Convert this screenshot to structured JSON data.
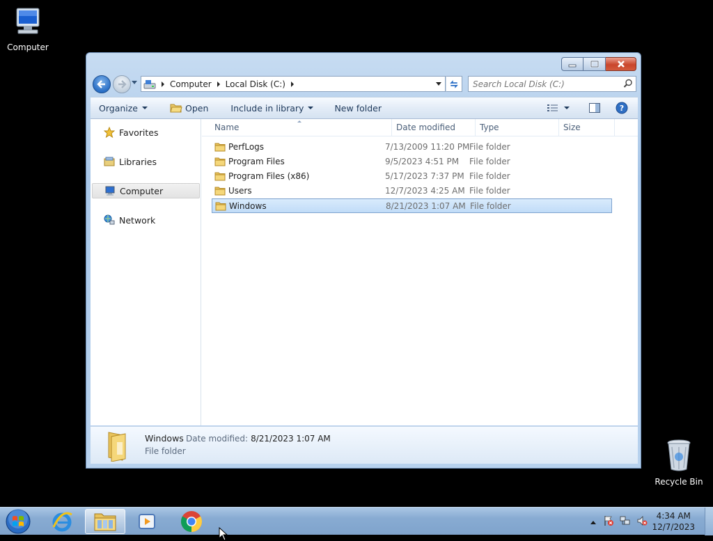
{
  "desktop": {
    "computer_label": "Computer",
    "recycle_bin_label": "Recycle Bin"
  },
  "window": {
    "address": {
      "crumbs": [
        "Computer",
        "Local Disk (C:)"
      ]
    },
    "search": {
      "placeholder": "Search Local Disk (C:)"
    },
    "toolbar": {
      "organize": "Organize",
      "open": "Open",
      "include_in_library": "Include in library",
      "new_folder": "New folder"
    },
    "nav": {
      "favorites": "Favorites",
      "libraries": "Libraries",
      "computer": "Computer",
      "network": "Network"
    },
    "columns": {
      "name": "Name",
      "date_modified": "Date modified",
      "type": "Type",
      "size": "Size"
    },
    "files": [
      {
        "name": "PerfLogs",
        "date": "7/13/2009 11:20 PM",
        "type": "File folder"
      },
      {
        "name": "Program Files",
        "date": "9/5/2023 4:51 PM",
        "type": "File folder"
      },
      {
        "name": "Program Files (x86)",
        "date": "5/17/2023 7:37 PM",
        "type": "File folder"
      },
      {
        "name": "Users",
        "date": "12/7/2023 4:25 AM",
        "type": "File folder"
      },
      {
        "name": "Windows",
        "date": "8/21/2023 1:07 AM",
        "type": "File folder"
      }
    ],
    "details": {
      "name": "Windows",
      "date_label": "Date modified:",
      "date_value": "8/21/2023 1:07 AM",
      "type": "File folder"
    }
  },
  "taskbar": {
    "time": "4:34 AM",
    "date": "12/7/2023"
  },
  "colors": {
    "selection": "#c1dcf8",
    "accent": "#1e395b"
  }
}
